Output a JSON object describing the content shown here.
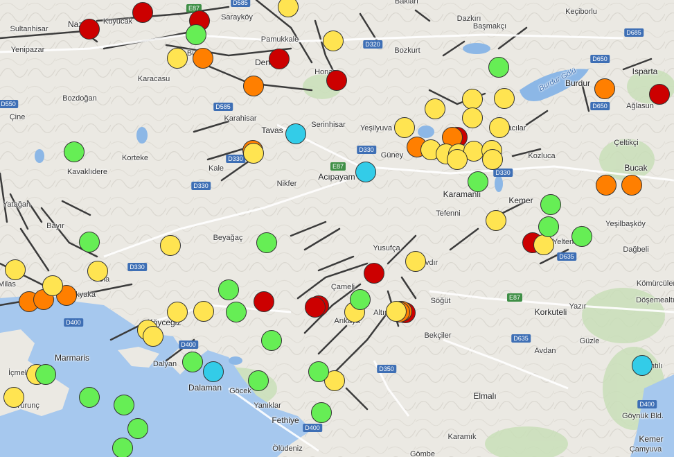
{
  "colors": {
    "red": "#cc0000",
    "orange": "#ff7f00",
    "yellow": "#ffe451",
    "green": "#66ee55",
    "cyan": "#33cce8",
    "sea": "#a6c8ee",
    "lake": "#8cb7e6",
    "road_shield": "#3e6fb5",
    "euro_shield": "#3f8f46"
  },
  "places": [
    "Kuyucak",
    "Sarayköy",
    "Nazilli",
    "Sultanhisar",
    "Pamukkale",
    "Bakları",
    "Dazkırı",
    "Keçiborlu",
    "Başmakçı",
    "Yenipazar",
    "Buldan",
    "Denizli",
    "Honaz",
    "Bozkurt",
    "Isparta",
    "Karacasu",
    "Bozdoğan",
    "Burdur",
    "Ağlasun",
    "Çine",
    "Karahisar",
    "Tavas",
    "Serinhisar",
    "Yeşilyuva",
    "Hacılar",
    "Çeltikçi",
    "Korteke",
    "Kavaklıdere",
    "Kale",
    "Acıpayam",
    "Güney",
    "Kozluca",
    "Bucak",
    "Nikfer",
    "Karamanlı",
    "Kemer",
    "Yatağan",
    "Bayır",
    "Tefenni",
    "Beyağaç",
    "Yeşilbaşköy",
    "Yelten",
    "Dağbeli",
    "Yusufça",
    "Çavdır",
    "Kömürcüler",
    "Döşemealtı",
    "Akyaka",
    "Çameli",
    "Altınyayla",
    "Korkuteli",
    "Köyceğiz",
    "Arıkaya",
    "Söğüt",
    "Yazır",
    "Bekçiler",
    "Güzle",
    "Avdan",
    "Bahtılı",
    "Marmaris",
    "Dalyan",
    "Dalaman",
    "Göcek",
    "Elmalı",
    "Yanıklar",
    "Fethiye",
    "Göynük Bld.",
    "Ölüdeniz",
    "Karamık",
    "Gömbe",
    "Kemer",
    "Çamyuva",
    "Burdur Gölü",
    "Ula",
    "Milas",
    "İçmeler",
    "Turunç"
  ],
  "roads": [
    "D585",
    "E87",
    "D320",
    "D685",
    "D550",
    "D650",
    "D585",
    "D330",
    "E87",
    "D330",
    "D330",
    "D330",
    "D650",
    "D330",
    "D635",
    "E87",
    "D400",
    "D635",
    "D400",
    "D350",
    "D400",
    "D400"
  ],
  "legend_levels": [
    "red",
    "orange",
    "yellow",
    "green",
    "cyan"
  ],
  "quakes": [
    {
      "color": "red"
    },
    {
      "color": "red"
    },
    {
      "color": "red"
    },
    {
      "color": "red"
    },
    {
      "color": "red"
    },
    {
      "color": "red"
    },
    {
      "color": "red"
    },
    {
      "color": "red"
    },
    {
      "color": "red"
    },
    {
      "color": "red"
    },
    {
      "color": "red"
    },
    {
      "color": "red"
    },
    {
      "color": "red"
    },
    {
      "color": "orange"
    },
    {
      "color": "orange"
    },
    {
      "color": "orange"
    },
    {
      "color": "orange"
    },
    {
      "color": "orange"
    },
    {
      "color": "orange"
    },
    {
      "color": "orange"
    },
    {
      "color": "orange"
    },
    {
      "color": "orange"
    },
    {
      "color": "orange"
    },
    {
      "color": "orange"
    },
    {
      "color": "orange"
    },
    {
      "color": "orange"
    },
    {
      "color": "orange"
    },
    {
      "color": "yellow"
    },
    {
      "color": "yellow"
    },
    {
      "color": "yellow"
    },
    {
      "color": "yellow"
    },
    {
      "color": "yellow"
    },
    {
      "color": "yellow"
    },
    {
      "color": "yellow"
    },
    {
      "color": "yellow"
    },
    {
      "color": "yellow"
    },
    {
      "color": "yellow"
    },
    {
      "color": "yellow"
    },
    {
      "color": "yellow"
    },
    {
      "color": "yellow"
    },
    {
      "color": "yellow"
    },
    {
      "color": "yellow"
    },
    {
      "color": "yellow"
    },
    {
      "color": "yellow"
    },
    {
      "color": "yellow"
    },
    {
      "color": "yellow"
    },
    {
      "color": "yellow"
    },
    {
      "color": "yellow"
    },
    {
      "color": "yellow"
    },
    {
      "color": "yellow"
    },
    {
      "color": "yellow"
    },
    {
      "color": "yellow"
    },
    {
      "color": "yellow"
    },
    {
      "color": "yellow"
    },
    {
      "color": "yellow"
    },
    {
      "color": "yellow"
    },
    {
      "color": "yellow"
    },
    {
      "color": "yellow"
    },
    {
      "color": "yellow"
    },
    {
      "color": "yellow"
    },
    {
      "color": "green"
    },
    {
      "color": "green"
    },
    {
      "color": "green"
    },
    {
      "color": "green"
    },
    {
      "color": "green"
    },
    {
      "color": "green"
    },
    {
      "color": "green"
    },
    {
      "color": "green"
    },
    {
      "color": "green"
    },
    {
      "color": "green"
    },
    {
      "color": "green"
    },
    {
      "color": "green"
    },
    {
      "color": "green"
    },
    {
      "color": "green"
    },
    {
      "color": "green"
    },
    {
      "color": "green"
    },
    {
      "color": "green"
    },
    {
      "color": "green"
    },
    {
      "color": "green"
    },
    {
      "color": "green"
    },
    {
      "color": "green"
    },
    {
      "color": "green"
    },
    {
      "color": "cyan"
    },
    {
      "color": "cyan"
    },
    {
      "color": "cyan"
    },
    {
      "color": "cyan"
    },
    {
      "color": "cyan"
    }
  ]
}
